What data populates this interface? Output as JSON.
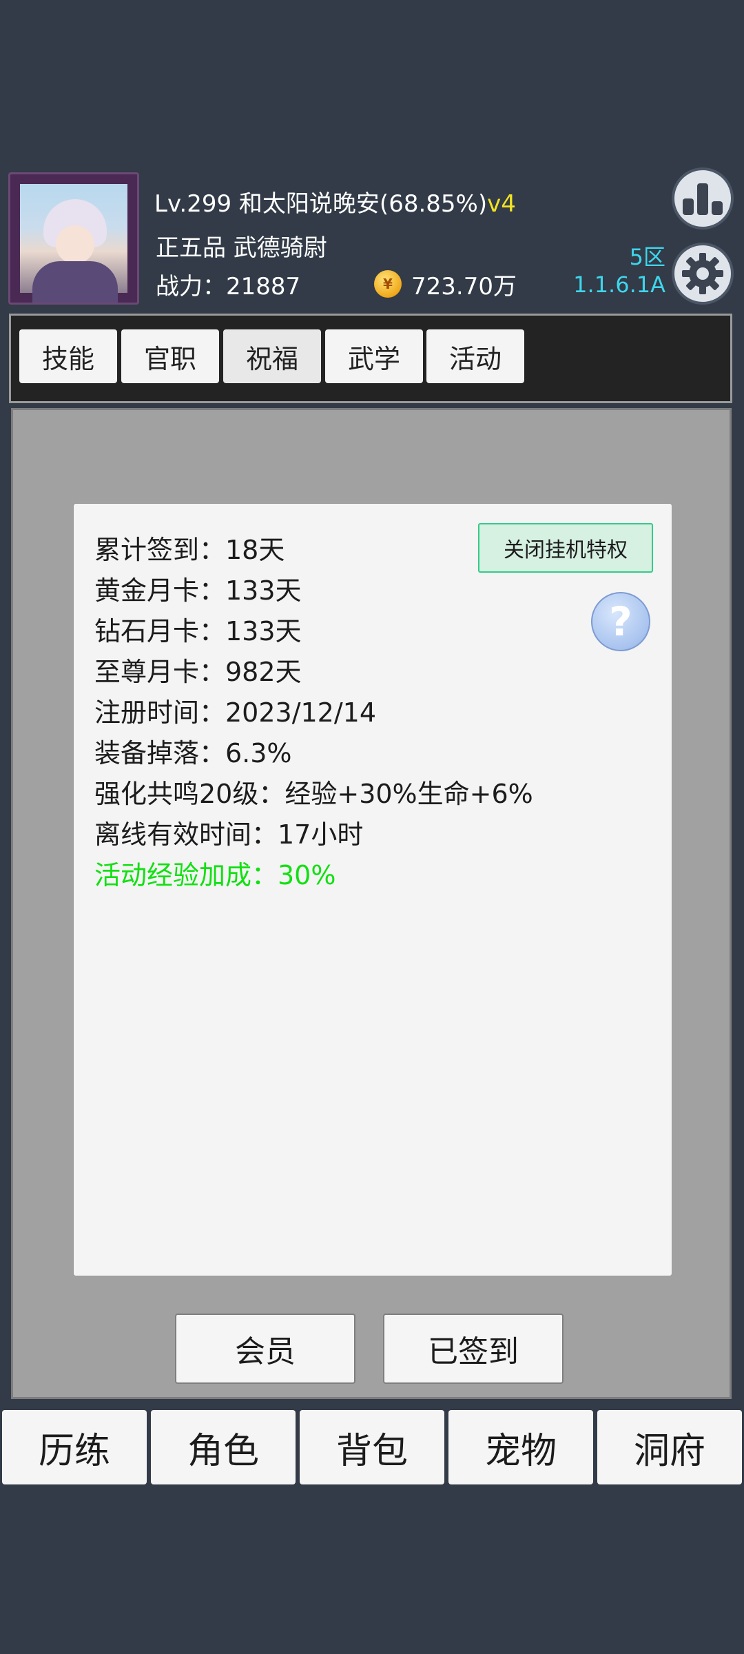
{
  "header": {
    "level_name": "Lv.299 和太阳说晚安(68.85%)",
    "vip": "v4",
    "rank": "正五品 武德骑尉",
    "power": "战力：21887",
    "gold": "723.70万",
    "server": "5区",
    "version": "1.1.6.1A",
    "icons": {
      "rank": "bar-chart-icon",
      "settings": "gear-icon",
      "gold": "gold-coin-icon"
    }
  },
  "tabs": [
    {
      "label": "技能"
    },
    {
      "label": "官职"
    },
    {
      "label": "祝福",
      "active": true
    },
    {
      "label": "武学"
    },
    {
      "label": "活动"
    }
  ],
  "info": {
    "lines": [
      "累计签到：18天",
      "黄金月卡：133天",
      "钻石月卡：133天",
      "至尊月卡：982天",
      "注册时间：2023/12/14",
      "装备掉落：6.3%",
      "强化共鸣20级：经验+30%生命+6%",
      "离线有效时间：17小时"
    ],
    "highlight": "活动经验加成：30%",
    "highlight_color": "#11e011",
    "close_button": "关闭挂机特权",
    "help_icon": "?"
  },
  "actions": {
    "member": "会员",
    "signed": "已签到"
  },
  "nav": [
    {
      "label": "历练"
    },
    {
      "label": "角色"
    },
    {
      "label": "背包"
    },
    {
      "label": "宠物"
    },
    {
      "label": "洞府"
    }
  ]
}
